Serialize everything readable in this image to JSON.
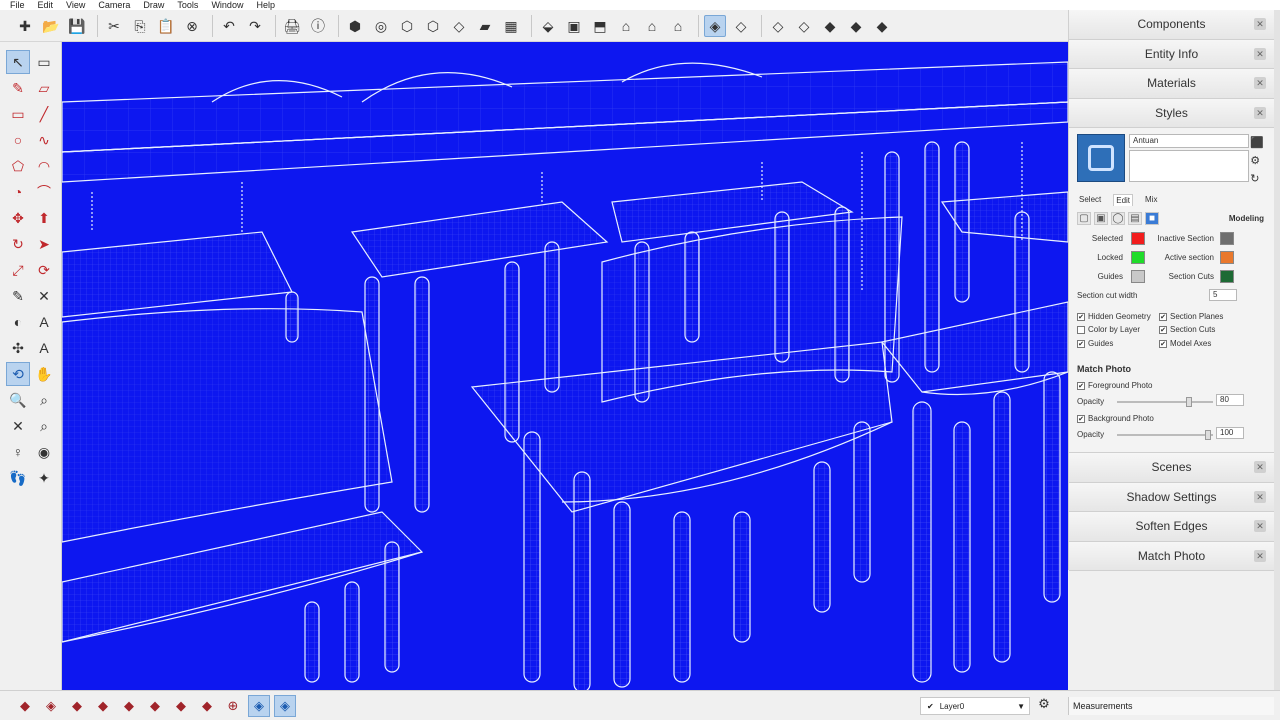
{
  "menu": [
    "File",
    "Edit",
    "View",
    "Camera",
    "Draw",
    "Tools",
    "Window",
    "Help"
  ],
  "toolbar_icons": [
    {
      "name": "new-file-icon",
      "glyph": "✚"
    },
    {
      "name": "open-folder-icon",
      "glyph": "📂"
    },
    {
      "name": "save-icon",
      "glyph": "💾"
    },
    {
      "sep": true
    },
    {
      "name": "cut-icon",
      "glyph": "✂"
    },
    {
      "name": "copy-icon",
      "glyph": "⎘"
    },
    {
      "name": "paste-icon",
      "glyph": "📋"
    },
    {
      "name": "erase-icon",
      "glyph": "⊗"
    },
    {
      "sep": true
    },
    {
      "name": "undo-icon",
      "glyph": "↶"
    },
    {
      "name": "redo-icon",
      "glyph": "↷"
    },
    {
      "sep": true
    },
    {
      "name": "print-icon",
      "glyph": "🖨"
    },
    {
      "name": "model-info-icon",
      "glyph": "ⓘ"
    },
    {
      "sep": true
    },
    {
      "name": "warehouse-icon",
      "glyph": "⬢"
    },
    {
      "name": "share-model-icon",
      "glyph": "◎"
    },
    {
      "name": "share-component-icon",
      "glyph": "⬡"
    },
    {
      "name": "get-models-icon",
      "glyph": "⬡"
    },
    {
      "name": "extension-icon",
      "glyph": "◇"
    },
    {
      "name": "layout-icon",
      "glyph": "▰"
    },
    {
      "name": "ruby-icon",
      "glyph": "▦"
    },
    {
      "sep": true
    },
    {
      "name": "iso-view-icon",
      "glyph": "⬙"
    },
    {
      "name": "top-view-icon",
      "glyph": "▣"
    },
    {
      "name": "front-view-icon",
      "glyph": "⬒"
    },
    {
      "name": "right-view-icon",
      "glyph": "⌂"
    },
    {
      "name": "back-view-icon",
      "glyph": "⌂"
    },
    {
      "name": "left-view-icon",
      "glyph": "⌂"
    },
    {
      "sep": true
    },
    {
      "name": "xray-icon",
      "glyph": "◈",
      "selected": true
    },
    {
      "name": "back-edges-icon",
      "glyph": "◇"
    },
    {
      "sep": true
    },
    {
      "name": "wireframe-icon",
      "glyph": "◇"
    },
    {
      "name": "hidden-line-icon",
      "glyph": "◇"
    },
    {
      "name": "shaded-icon",
      "glyph": "◆"
    },
    {
      "name": "shaded-textures-icon",
      "glyph": "◆"
    },
    {
      "name": "monochrome-icon",
      "glyph": "◆"
    }
  ],
  "left_tools": [
    {
      "name": "select-tool-icon",
      "glyph": "↖",
      "selected": true
    },
    {
      "name": "make-component-icon",
      "glyph": "▭"
    },
    {
      "name": "paint-bucket-icon",
      "glyph": "✎",
      "color": "red"
    },
    {
      "name": "eraser-icon",
      "glyph": "▱",
      "color": "red"
    },
    {
      "name": "rectangle-icon",
      "glyph": "▭",
      "color": "red"
    },
    {
      "name": "line-icon",
      "glyph": "╱",
      "color": "red"
    },
    {
      "name": "circle-icon",
      "glyph": "○",
      "color": "red"
    },
    {
      "name": "freehand-icon",
      "glyph": "∿",
      "color": "red"
    },
    {
      "name": "polygon-icon",
      "glyph": "⬠",
      "color": "red"
    },
    {
      "name": "arc-icon",
      "glyph": "◠",
      "color": "red"
    },
    {
      "name": "pie-icon",
      "glyph": "◔",
      "color": "red"
    },
    {
      "name": "two-point-arc-icon",
      "glyph": "⌒",
      "color": "red"
    },
    {
      "name": "move-icon",
      "glyph": "✥",
      "color": "red"
    },
    {
      "name": "push-pull-icon",
      "glyph": "⬆",
      "color": "red"
    },
    {
      "name": "rotate-icon",
      "glyph": "↻",
      "color": "red"
    },
    {
      "name": "follow-me-icon",
      "glyph": "➤",
      "color": "red"
    },
    {
      "name": "scale-icon",
      "glyph": "⤢",
      "color": "red"
    },
    {
      "name": "offset-icon",
      "glyph": "⟳",
      "color": "red"
    },
    {
      "name": "tape-measure-icon",
      "glyph": "✎"
    },
    {
      "name": "dimension-icon",
      "glyph": "✕"
    },
    {
      "name": "protractor-icon",
      "glyph": "◐"
    },
    {
      "name": "text-icon",
      "glyph": "A"
    },
    {
      "name": "axes-icon",
      "glyph": "✣"
    },
    {
      "name": "3d-text-icon",
      "glyph": "A"
    },
    {
      "name": "orbit-icon",
      "glyph": "⟲",
      "color": "blue",
      "selected": true
    },
    {
      "name": "pan-icon",
      "glyph": "✋"
    },
    {
      "name": "zoom-icon",
      "glyph": "🔍"
    },
    {
      "name": "zoom-window-icon",
      "glyph": "⌕"
    },
    {
      "name": "zoom-extents-icon",
      "glyph": "✕"
    },
    {
      "name": "previous-view-icon",
      "glyph": "⌕"
    },
    {
      "name": "position-camera-icon",
      "glyph": "♀"
    },
    {
      "name": "look-around-icon",
      "glyph": "◉"
    },
    {
      "name": "walk-icon",
      "glyph": "👣"
    },
    {
      "name": "section-plane-icon",
      "glyph": "✦"
    }
  ],
  "tray": {
    "components": "Components",
    "entity_info": "Entity Info",
    "materials": "Materials",
    "styles": "Styles",
    "scenes": "Scenes",
    "shadow_settings": "Shadow Settings",
    "soften_edges": "Soften Edges",
    "match_photo": "Match Photo"
  },
  "styles": {
    "name_value": "Antuan",
    "tab_select": "Select",
    "tab_edit": "Edit",
    "tab_mix": "Mix",
    "mode_label": "Modeling",
    "selected_label": "Selected",
    "locked_label": "Locked",
    "guides_label": "Guides",
    "inactive_section_label": "Inactive Section",
    "active_section_label": "Active section",
    "section_cuts_label": "Section Cuts",
    "selected_color": "#f21d1d",
    "locked_color": "#1fdc2a",
    "guides_color": "#c8c8c8",
    "inactive_section_color": "#6e6e6e",
    "active_section_color": "#e9782c",
    "section_cuts_color": "#1d6a34",
    "section_cut_width_label": "Section cut width",
    "section_cut_width_value": "5",
    "hidden_geometry": "Hidden Geometry",
    "color_by_layer": "Color by Layer",
    "guides_check": "Guides",
    "section_planes": "Section Planes",
    "section_cuts_check": "Section Cuts",
    "model_axes": "Model Axes",
    "match_photo_heading": "Match Photo",
    "foreground_photo": "Foreground Photo",
    "opacity_label_1": "Opacity",
    "foreground_opacity": "80",
    "background_photo": "Background Photo",
    "opacity_label_2": "Opacity",
    "background_opacity": "100"
  },
  "bottom_icons": [
    {
      "name": "ruby-console-icon",
      "glyph": "◆"
    },
    {
      "name": "sandbox-icon",
      "glyph": "◈"
    },
    {
      "name": "solid-tools-icon",
      "glyph": "◆"
    },
    {
      "name": "warehouse-bottom-icon",
      "glyph": "◆"
    },
    {
      "name": "stamp-icon",
      "glyph": "◆"
    },
    {
      "name": "drape-icon",
      "glyph": "◆"
    },
    {
      "name": "add-detail-icon",
      "glyph": "◆"
    },
    {
      "name": "flip-edge-icon",
      "glyph": "◆"
    },
    {
      "name": "navigate-icon",
      "glyph": "⊕"
    },
    {
      "name": "xray-bottom-icon",
      "glyph": "◈",
      "selected": true
    },
    {
      "name": "back-edges-bottom-icon",
      "glyph": "◈",
      "selected": true
    }
  ],
  "status": {
    "layer_check": "✔",
    "layer_name": "Layer0",
    "measurements_label": "Measurements"
  },
  "colors": {
    "viewport_bg": "#0d17f0",
    "wire_color": "#e8f0ff"
  }
}
